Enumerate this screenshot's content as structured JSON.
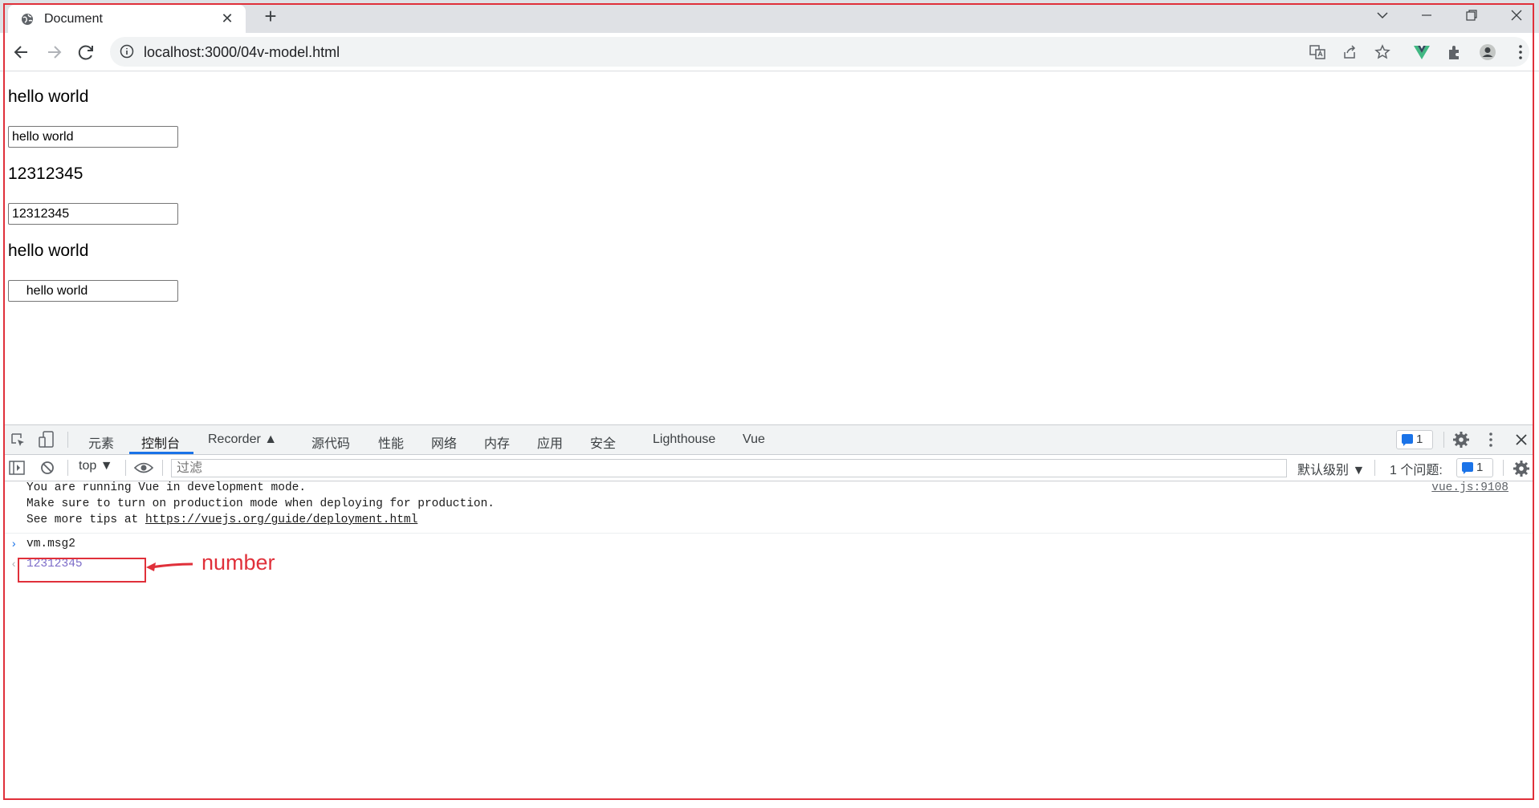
{
  "browser": {
    "tab_title": "Document",
    "tab_close": "✕",
    "new_tab": "+",
    "url": "localhost:3000/04v-model.html"
  },
  "page": {
    "line1": "hello world",
    "input1": "hello world",
    "line2": "12312345",
    "input2": "12312345",
    "line3": "hello world",
    "input3": "    hello world"
  },
  "devtools": {
    "tabs": [
      "元素",
      "控制台",
      "Recorder ▲",
      "源代码",
      "性能",
      "网络",
      "内存",
      "应用",
      "安全",
      "Lighthouse",
      "Vue"
    ],
    "issues_badge": "1",
    "context": "top ▼",
    "filter_placeholder": "过滤",
    "level": "默认级别 ▼",
    "issues_label": "1 个问题:",
    "issues_count": "1",
    "log": {
      "line1": "You are running Vue in development mode.",
      "line2": "Make sure to turn on production mode when deploying for production.",
      "line3_prefix": "See more tips at ",
      "line3_link": "https://vuejs.org/guide/deployment.html",
      "source": "vue.js:9108"
    },
    "command": "vm.msg2",
    "result": "12312345"
  },
  "annotation": {
    "label": "number",
    "color": "#e0303a"
  }
}
